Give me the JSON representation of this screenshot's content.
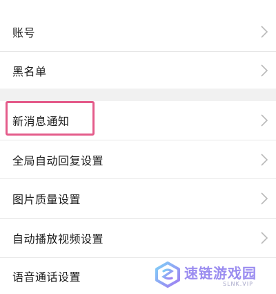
{
  "settings_list": {
    "items": [
      {
        "label": "账号"
      },
      {
        "label": "黑名单"
      },
      {
        "label": "新消息通知"
      },
      {
        "label": "全局自动回复设置"
      },
      {
        "label": "图片质量设置"
      },
      {
        "label": "自动播放视频设置"
      },
      {
        "label": "语音通话设置"
      }
    ],
    "highlight_color": "#e45b8a",
    "chevron_icon": "chevron-right-icon"
  },
  "watermark": {
    "text": "速链游戏园",
    "subtext": "SLNK.VIP",
    "color": "#9a8cf0"
  }
}
